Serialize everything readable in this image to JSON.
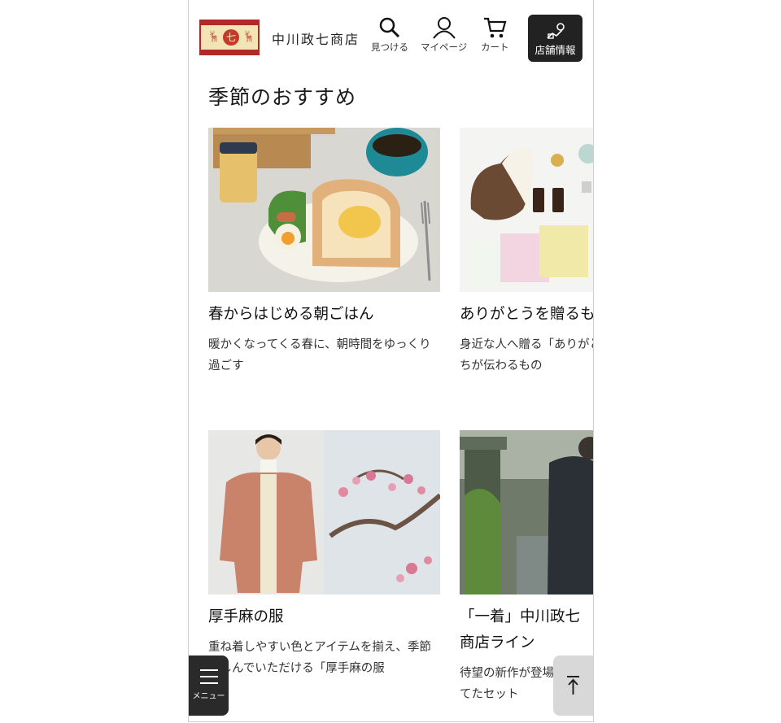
{
  "header": {
    "logo_text": "七",
    "shop_name": "中川政七商店",
    "nav": {
      "search_label": "見つける",
      "mypage_label": "マイページ",
      "cart_label": "カート",
      "store_label": "店舗情報"
    }
  },
  "section": {
    "title": "季節のおすすめ"
  },
  "cards": [
    {
      "title": "春からはじめる朝ごはん",
      "desc": "暖かくなってくる春に、朝時間をゆっくり過ごす"
    },
    {
      "title": "ありがとうを贈るも",
      "desc": "身近な人へ贈る「ありがとうの気持ちが伝わるもの"
    },
    {
      "title": "厚手麻の服",
      "desc": "重ね着しやすい色とアイテムを揃え、季節楽しんでいただける「厚手麻の服"
    },
    {
      "title": "「一着」中川政七商店ライン",
      "desc": "待望の新作が登場仕立てたセット"
    }
  ],
  "floating": {
    "menu_label": "メニュー"
  },
  "colors": {
    "accent_dark": "#222222",
    "logo_red": "#b12a2a"
  }
}
